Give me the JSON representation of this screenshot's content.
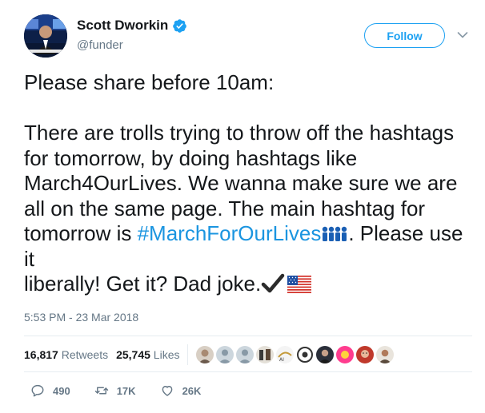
{
  "user": {
    "display_name": "Scott Dworkin",
    "handle": "@funder",
    "verified_icon": "verified-badge-icon"
  },
  "header": {
    "follow_label": "Follow",
    "caret_icon": "chevron-down-icon"
  },
  "tweet": {
    "line1": "Please share before 10am:",
    "para2": "There are trolls trying to throw off the hashtags for tomorrow, by doing hashtags like March4OurLives. We wanna make sure we are all on the same page. The main hashtag for tomorrow is ",
    "hashtag": "#MarchForOurLives",
    "hashtag_emoji": "people-group-icon",
    "para2_end_a": ". Please use it",
    "para2_end_b": "liberally! Get it? Dad joke.",
    "end_emoji_1": "check-mark-icon",
    "end_emoji_2": "us-flag-icon"
  },
  "timestamp": "5:53 PM - 23 Mar 2018",
  "stats": {
    "retweets_count": "16,817",
    "retweets_label": "Retweets",
    "likes_count": "25,745",
    "likes_label": "Likes"
  },
  "actions": {
    "reply_count": "490",
    "retweet_count": "17K",
    "like_count": "26K"
  },
  "colors": {
    "accent": "#1da1f2",
    "link": "#1b95e0",
    "muted": "#657786",
    "text": "#14171a"
  }
}
